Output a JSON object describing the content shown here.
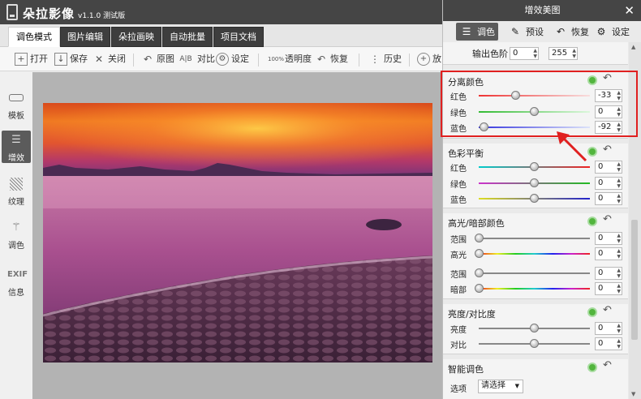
{
  "app": {
    "title": "朵拉影像",
    "version": "v1.1.0 测试版"
  },
  "tabs": [
    "调色模式",
    "图片编辑",
    "朵拉画映",
    "自动批量",
    "项目文档"
  ],
  "toolbar": {
    "open": "打开",
    "save": "保存",
    "close": "关闭",
    "original": "原图",
    "compare": "对比",
    "settings": "设定",
    "transparency": "透明度",
    "restore": "恢复",
    "history": "历史",
    "zoom": "放",
    "ab_icon": "A|B",
    "pct_icon": "100%"
  },
  "sidebar": [
    {
      "label": "模板",
      "icon": "template-icon"
    },
    {
      "label": "增效",
      "icon": "enhance-sliders-icon"
    },
    {
      "label": "纹理",
      "icon": "texture-icon"
    },
    {
      "label": "调色",
      "icon": "magic-wand-icon"
    },
    {
      "label": "信息",
      "icon": "exif-icon",
      "icon_text": "EXIF"
    }
  ],
  "panel": {
    "title": "增效美图",
    "close": "✕",
    "tabs": [
      "调色",
      "预设",
      "恢复",
      "设定"
    ],
    "output_levels": {
      "label": "输出色阶",
      "min": "0",
      "max": "255"
    },
    "sections": [
      {
        "title": "分离颜色",
        "rows": [
          {
            "label": "红色",
            "value": "-33"
          },
          {
            "label": "绿色",
            "value": "0"
          },
          {
            "label": "蓝色",
            "value": "-92"
          }
        ]
      },
      {
        "title": "色彩平衡",
        "rows": [
          {
            "label": "红色",
            "value": "0"
          },
          {
            "label": "绿色",
            "value": "0"
          },
          {
            "label": "蓝色",
            "value": "0"
          }
        ]
      },
      {
        "title": "高光/暗部颜色",
        "rows": [
          {
            "label": "范围",
            "value": "0"
          },
          {
            "label": "高光",
            "value": "0"
          },
          {
            "label": "范围",
            "value": "0"
          },
          {
            "label": "暗部",
            "value": "0"
          }
        ]
      },
      {
        "title": "亮度/对比度",
        "rows": [
          {
            "label": "亮度",
            "value": "0"
          },
          {
            "label": "对比",
            "value": "0"
          }
        ]
      },
      {
        "title": "智能调色",
        "option_label": "选项",
        "select_value": "请选择"
      }
    ]
  },
  "colors": {
    "highlight": "#e02020",
    "check": "#52b53d",
    "dark_bar": "#454545"
  }
}
